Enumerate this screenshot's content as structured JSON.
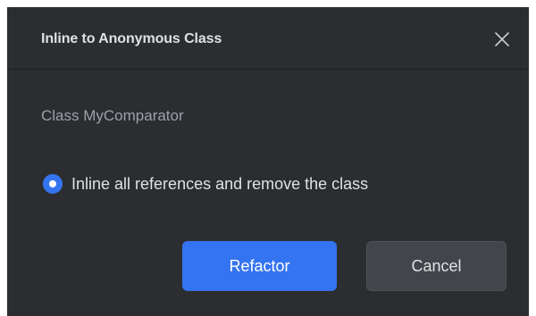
{
  "dialog": {
    "title": "Inline to Anonymous Class",
    "close_icon": "close-icon",
    "class_label": "Class MyComparator",
    "option": {
      "label": "Inline all references and remove the class",
      "selected": true
    },
    "buttons": {
      "refactor": "Refactor",
      "cancel": "Cancel"
    }
  },
  "colors": {
    "background": "#2b2d30",
    "accent": "#3574f0",
    "secondary_button": "#43454a",
    "text": "#dfe1e5",
    "muted_text": "#9da0a8"
  }
}
